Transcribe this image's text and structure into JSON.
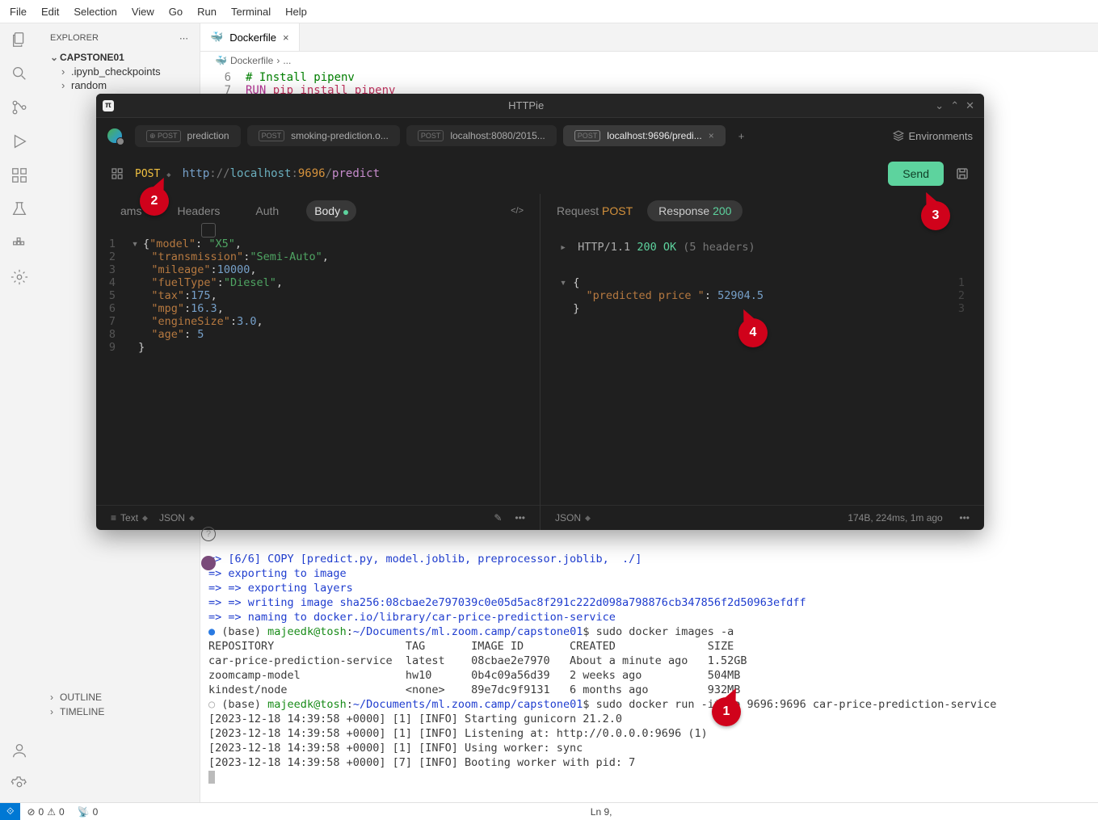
{
  "vscode": {
    "menubar": [
      "File",
      "Edit",
      "Selection",
      "View",
      "Go",
      "Run",
      "Terminal",
      "Help"
    ],
    "explorer": {
      "title": "EXPLORER",
      "folder": "CAPSTONE01",
      "items": [
        ".ipynb_checkpoints",
        "random"
      ],
      "outline": "OUTLINE",
      "timeline": "TIMELINE"
    },
    "tab": "Dockerfile",
    "breadcrumb": [
      "Dockerfile",
      "..."
    ],
    "editor": {
      "l6": {
        "n": "6",
        "text": "# Install pipenv"
      },
      "l7": {
        "n": "7",
        "run": "RUN",
        "cmd": "pip install pipenv"
      }
    },
    "terminal": {
      "l1": "=> [6/6] COPY [predict.py, model.joblib, preprocessor.joblib,  ./]",
      "l2": "=> exporting to image",
      "l3": "=> => exporting layers",
      "l4": "=> => writing image sha256:08cbae2e797039c0e05d5ac8f291c222d098a798876cb347856f2d50963efdff",
      "l5": "=> => naming to docker.io/library/car-price-prediction-service",
      "prompt1_user": "majeedk@tosh",
      "prompt1_path": "~/Documents/ml.zoom.camp/capstone01",
      "prompt1_cmd": "sudo docker images -a",
      "prompt1_prefix": "(base) ",
      "header": "REPOSITORY                    TAG       IMAGE ID       CREATED              SIZE",
      "row1": "car-price-prediction-service  latest    08cbae2e7970   About a minute ago   1.52GB",
      "row2": "zoomcamp-model                hw10      0b4c09a56d39   2 weeks ago          504MB",
      "row3": "kindest/node                  <none>    89e7dc9f9131   6 months ago         932MB",
      "prompt2_cmd": "sudo docker run -it -p 9696:9696 car-price-prediction-service",
      "g1": "[2023-12-18 14:39:58 +0000] [1] [INFO] Starting gunicorn 21.2.0",
      "g2": "[2023-12-18 14:39:58 +0000] [1] [INFO] Listening at: http://0.0.0.0:9696 (1)",
      "g3": "[2023-12-18 14:39:58 +0000] [1] [INFO] Using worker: sync",
      "g4": "[2023-12-18 14:39:58 +0000] [7] [INFO] Booting worker with pid: 7"
    },
    "status": {
      "errors": "0",
      "warnings": "0",
      "ports": "0",
      "ln": "Ln 9,"
    }
  },
  "httpie": {
    "title": "HTTPie",
    "tabs": [
      {
        "method": "POST",
        "label": "prediction"
      },
      {
        "method": "POST",
        "label": "smoking-prediction.o..."
      },
      {
        "method": "POST",
        "label": "localhost:8080/2015..."
      },
      {
        "method": "POST",
        "label": "localhost:9696/predi..."
      }
    ],
    "env": "Environments",
    "method": "POST",
    "url": {
      "scheme": "http",
      "sep": "://",
      "host": "localhost",
      "port": "9696",
      "path": "/predict"
    },
    "send": "Send",
    "reqtabs": {
      "params": "ams",
      "headers": "Headers",
      "auth": "Auth",
      "body": "Body"
    },
    "body_json": {
      "l1": {
        "k": "\"model\"",
        "v": "\"X5\""
      },
      "l2": {
        "k": "\"transmission\"",
        "v": "\"Semi-Auto\""
      },
      "l3": {
        "k": "\"mileage\"",
        "v": "10000"
      },
      "l4": {
        "k": "\"fuelType\"",
        "v": "\"Diesel\""
      },
      "l5": {
        "k": "\"tax\"",
        "v": "175"
      },
      "l6": {
        "k": "\"mpg\"",
        "v": "16.3"
      },
      "l7": {
        "k": "\"engineSize\"",
        "v": "3.0"
      },
      "l8": {
        "k": "\"age\"",
        "v": "5"
      }
    },
    "left_footer": {
      "text": "Text",
      "json": "JSON"
    },
    "resp": {
      "req_label": "Request",
      "req_method": "POST",
      "resp_label": "Response",
      "resp_code": "200",
      "proto": "HTTP/1.1",
      "status": "200 OK",
      "headers": "(5 headers)",
      "key": "\"predicted price \"",
      "value": "52904.5"
    },
    "right_footer": {
      "json": "JSON",
      "meta": "174B, 224ms, 1m ago"
    }
  },
  "callouts": {
    "c1": "1",
    "c2": "2",
    "c3": "3",
    "c4": "4"
  }
}
